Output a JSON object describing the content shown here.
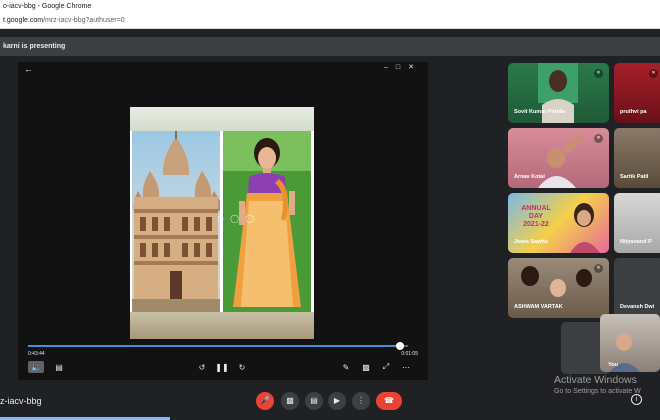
{
  "window": {
    "title": "o-iacv-bbg - Google Chrome",
    "url_host": "t.google.com",
    "url_path": "/mrz-iacv-bbg?authuser=0"
  },
  "banner": {
    "text": "karni is presenting"
  },
  "presentation": {
    "elapsed": "0:43:44",
    "remaining": "0:01:05",
    "progress": 0.98,
    "back_icon": "back-arrow-icon",
    "window_controls": [
      "minimize-icon",
      "maximize-icon",
      "close-icon"
    ]
  },
  "participants": [
    {
      "name": "Sovit Kumar Parida"
    },
    {
      "name": "pruthvi pa"
    },
    {
      "name": "Arnav Kotal"
    },
    {
      "name": "Sartik Patil"
    },
    {
      "name": "Jiwes Sawhe"
    },
    {
      "name": "Nityanand P"
    },
    {
      "name": "ASHWAM VARTAK"
    },
    {
      "name": "Devansh Dwi"
    },
    {
      "name": "You"
    }
  ],
  "banner_in_tile": {
    "line1": "ANNUAL",
    "line2": "DAY",
    "line3": "2021-22"
  },
  "bottom": {
    "meeting_code": "z-iacv-bbg"
  },
  "watermark": {
    "line1": "Activate Windows",
    "line2": "Go to Settings to activate W"
  },
  "colors": {
    "accent": "#4a90d9",
    "danger": "#ea4335",
    "background": "#202124"
  }
}
